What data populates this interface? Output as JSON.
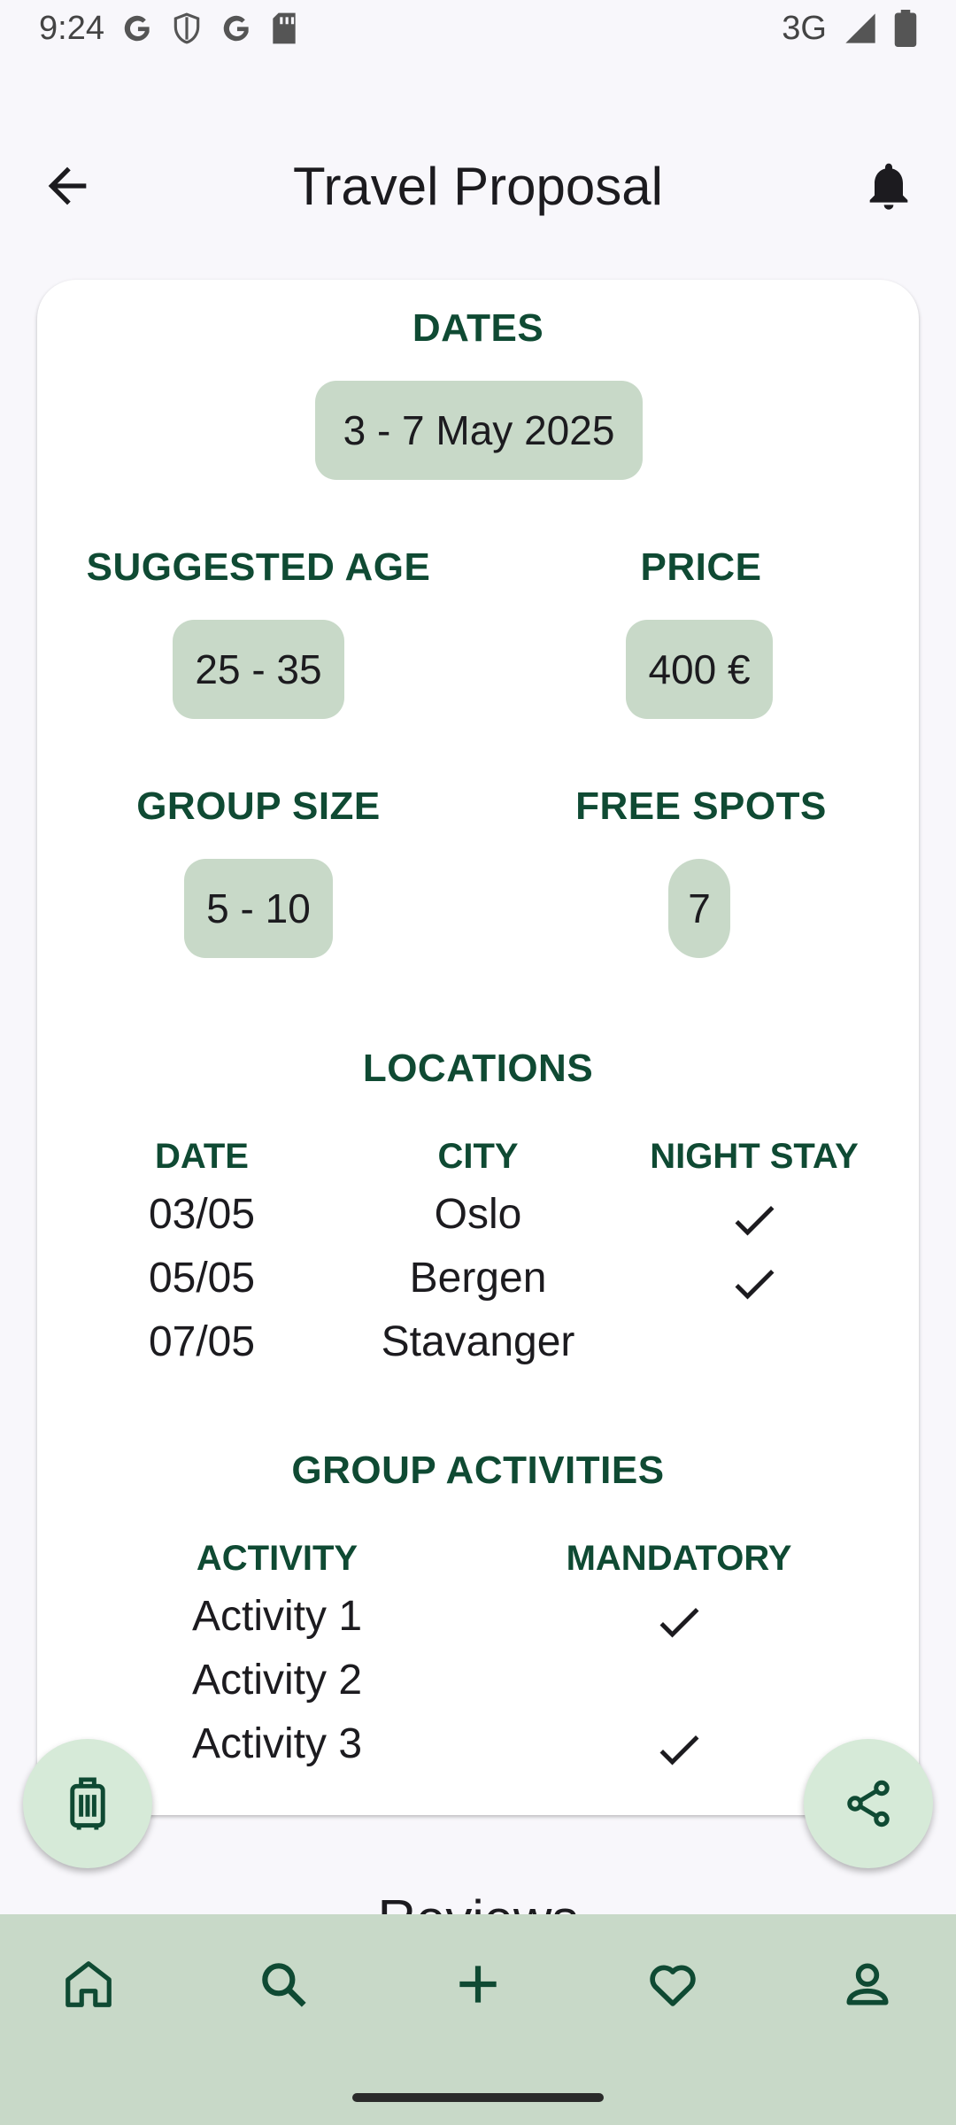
{
  "status_bar": {
    "time": "9:24",
    "network": "3G"
  },
  "app_bar": {
    "title": "Travel Proposal"
  },
  "dates": {
    "label": "DATES",
    "value": "3 - 7 May 2025"
  },
  "age": {
    "label": "SUGGESTED AGE",
    "value": "25 - 35"
  },
  "price": {
    "label": "PRICE",
    "value": "400 €"
  },
  "group_size": {
    "label": "GROUP SIZE",
    "value": "5 - 10"
  },
  "free_spots": {
    "label": "FREE SPOTS",
    "value": "7"
  },
  "locations": {
    "label": "LOCATIONS",
    "headers": [
      "DATE",
      "CITY",
      "NIGHT STAY"
    ],
    "rows": [
      {
        "date": "03/05",
        "city": "Oslo",
        "night_stay": true
      },
      {
        "date": "05/05",
        "city": "Bergen",
        "night_stay": true
      },
      {
        "date": "07/05",
        "city": "Stavanger",
        "night_stay": false
      }
    ]
  },
  "activities": {
    "label": "GROUP ACTIVITIES",
    "headers": [
      "ACTIVITY",
      "MANDATORY"
    ],
    "rows": [
      {
        "name": "Activity 1",
        "mandatory": true
      },
      {
        "name": "Activity 2",
        "mandatory": false
      },
      {
        "name": "Activity 3",
        "mandatory": true
      }
    ]
  },
  "reviews_peek": "Reviews",
  "fabs": {
    "left_icon": "luggage-icon",
    "right_icon": "share-icon"
  },
  "bottom_nav": [
    "home-icon",
    "search-icon",
    "add-icon",
    "heart-icon",
    "profile-icon"
  ],
  "colors": {
    "accent": "#0f4a33",
    "chip": "#c8d9c8",
    "nav": "#c8d9c8",
    "fab": "#d6ead8"
  }
}
